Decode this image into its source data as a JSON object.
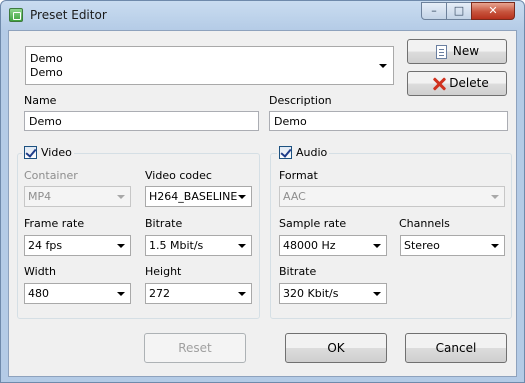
{
  "window": {
    "title": "Preset Editor"
  },
  "preset_select": {
    "line1": "Demo",
    "line2": "Demo"
  },
  "buttons": {
    "new": "New",
    "delete": "Delete",
    "reset": "Reset",
    "ok": "OK",
    "cancel": "Cancel"
  },
  "name": {
    "label": "Name",
    "value": "Demo"
  },
  "description": {
    "label": "Description",
    "value": "Demo"
  },
  "video": {
    "label": "Video",
    "checked": true,
    "container_label": "Container",
    "container_value": "MP4",
    "codec_label": "Video codec",
    "codec_value": "H264_BASELINE",
    "framerate_label": "Frame rate",
    "framerate_value": "24 fps",
    "bitrate_label": "Bitrate",
    "bitrate_value": "1.5 Mbit/s",
    "width_label": "Width",
    "width_value": "480",
    "height_label": "Height",
    "height_value": "272"
  },
  "audio": {
    "label": "Audio",
    "checked": true,
    "format_label": "Format",
    "format_value": "AAC",
    "samplerate_label": "Sample rate",
    "samplerate_value": "48000 Hz",
    "channels_label": "Channels",
    "channels_value": "Stereo",
    "bitrate_label": "Bitrate",
    "bitrate_value": "320 Kbit/s"
  },
  "icons": {
    "app": "preset-app-icon",
    "new": "new-document-icon",
    "delete": "red-x-icon"
  },
  "colors": {
    "close_button": "#c7543d",
    "delete_x": "#d0321f",
    "title_bar": "#b4cbe6"
  }
}
